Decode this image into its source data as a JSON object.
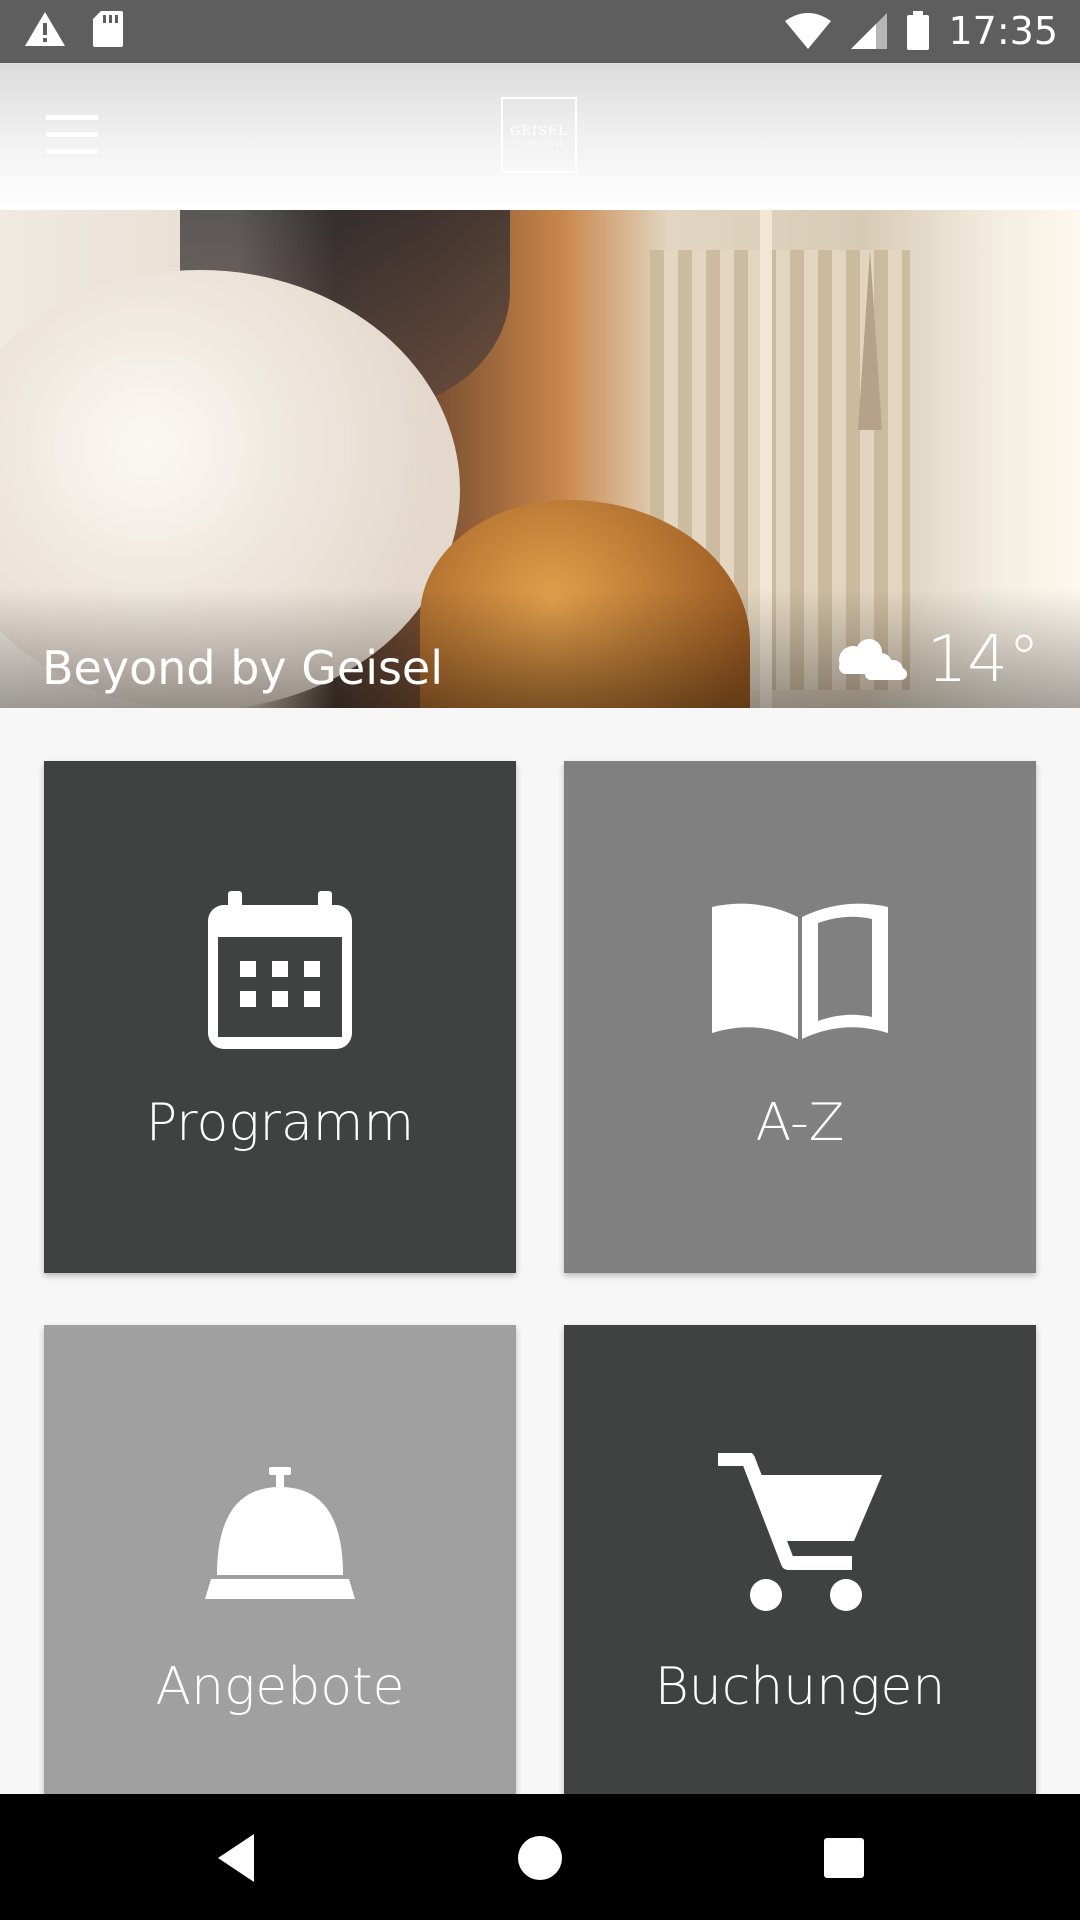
{
  "status_bar": {
    "time": "17:35",
    "left_icons": [
      "warning-icon",
      "sd-card-icon"
    ],
    "right_icons": [
      "wifi-icon",
      "signal-icon",
      "battery-icon"
    ]
  },
  "header": {
    "menu_icon": "hamburger-menu-icon",
    "logo_text": "GEISEL",
    "logo_subtext": "PRIVATHOTELS"
  },
  "hero": {
    "title": "Beyond by Geisel",
    "weather_icon": "cloudy-icon",
    "temperature": "14°"
  },
  "tiles": [
    {
      "label": "Programm",
      "icon": "calendar-icon",
      "color": "#404242"
    },
    {
      "label": "A-Z",
      "icon": "open-book-icon",
      "color": "#808080"
    },
    {
      "label": "Angebote",
      "icon": "service-bell-icon",
      "color": "#a0a0a0"
    },
    {
      "label": "Buchungen",
      "icon": "shopping-cart-icon",
      "color": "#404242"
    }
  ],
  "nav_bar": {
    "buttons": [
      "back-icon",
      "home-icon",
      "recents-icon"
    ]
  }
}
